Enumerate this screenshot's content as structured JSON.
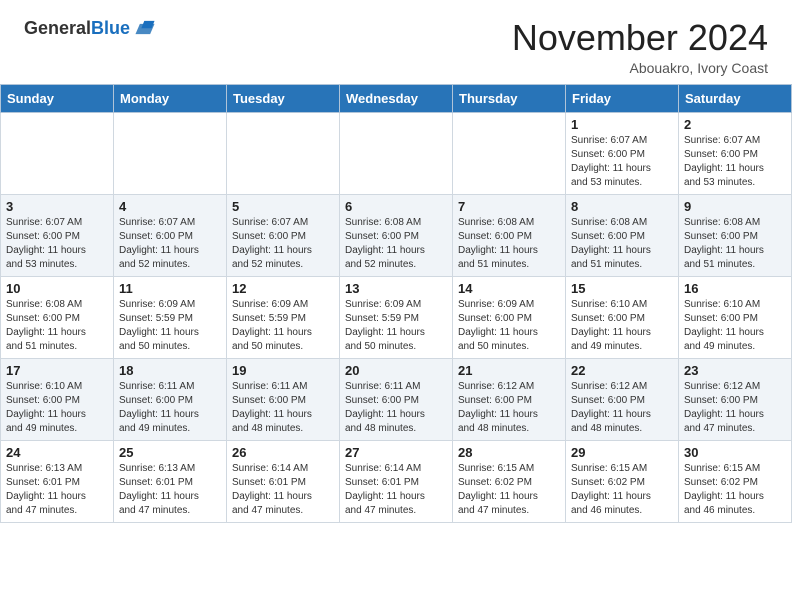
{
  "header": {
    "logo_general": "General",
    "logo_blue": "Blue",
    "month": "November 2024",
    "location": "Abouakro, Ivory Coast"
  },
  "calendar": {
    "days_of_week": [
      "Sunday",
      "Monday",
      "Tuesday",
      "Wednesday",
      "Thursday",
      "Friday",
      "Saturday"
    ],
    "weeks": [
      [
        {
          "day": "",
          "info": ""
        },
        {
          "day": "",
          "info": ""
        },
        {
          "day": "",
          "info": ""
        },
        {
          "day": "",
          "info": ""
        },
        {
          "day": "",
          "info": ""
        },
        {
          "day": "1",
          "info": "Sunrise: 6:07 AM\nSunset: 6:00 PM\nDaylight: 11 hours\nand 53 minutes."
        },
        {
          "day": "2",
          "info": "Sunrise: 6:07 AM\nSunset: 6:00 PM\nDaylight: 11 hours\nand 53 minutes."
        }
      ],
      [
        {
          "day": "3",
          "info": "Sunrise: 6:07 AM\nSunset: 6:00 PM\nDaylight: 11 hours\nand 53 minutes."
        },
        {
          "day": "4",
          "info": "Sunrise: 6:07 AM\nSunset: 6:00 PM\nDaylight: 11 hours\nand 52 minutes."
        },
        {
          "day": "5",
          "info": "Sunrise: 6:07 AM\nSunset: 6:00 PM\nDaylight: 11 hours\nand 52 minutes."
        },
        {
          "day": "6",
          "info": "Sunrise: 6:08 AM\nSunset: 6:00 PM\nDaylight: 11 hours\nand 52 minutes."
        },
        {
          "day": "7",
          "info": "Sunrise: 6:08 AM\nSunset: 6:00 PM\nDaylight: 11 hours\nand 51 minutes."
        },
        {
          "day": "8",
          "info": "Sunrise: 6:08 AM\nSunset: 6:00 PM\nDaylight: 11 hours\nand 51 minutes."
        },
        {
          "day": "9",
          "info": "Sunrise: 6:08 AM\nSunset: 6:00 PM\nDaylight: 11 hours\nand 51 minutes."
        }
      ],
      [
        {
          "day": "10",
          "info": "Sunrise: 6:08 AM\nSunset: 6:00 PM\nDaylight: 11 hours\nand 51 minutes."
        },
        {
          "day": "11",
          "info": "Sunrise: 6:09 AM\nSunset: 5:59 PM\nDaylight: 11 hours\nand 50 minutes."
        },
        {
          "day": "12",
          "info": "Sunrise: 6:09 AM\nSunset: 5:59 PM\nDaylight: 11 hours\nand 50 minutes."
        },
        {
          "day": "13",
          "info": "Sunrise: 6:09 AM\nSunset: 5:59 PM\nDaylight: 11 hours\nand 50 minutes."
        },
        {
          "day": "14",
          "info": "Sunrise: 6:09 AM\nSunset: 6:00 PM\nDaylight: 11 hours\nand 50 minutes."
        },
        {
          "day": "15",
          "info": "Sunrise: 6:10 AM\nSunset: 6:00 PM\nDaylight: 11 hours\nand 49 minutes."
        },
        {
          "day": "16",
          "info": "Sunrise: 6:10 AM\nSunset: 6:00 PM\nDaylight: 11 hours\nand 49 minutes."
        }
      ],
      [
        {
          "day": "17",
          "info": "Sunrise: 6:10 AM\nSunset: 6:00 PM\nDaylight: 11 hours\nand 49 minutes."
        },
        {
          "day": "18",
          "info": "Sunrise: 6:11 AM\nSunset: 6:00 PM\nDaylight: 11 hours\nand 49 minutes."
        },
        {
          "day": "19",
          "info": "Sunrise: 6:11 AM\nSunset: 6:00 PM\nDaylight: 11 hours\nand 48 minutes."
        },
        {
          "day": "20",
          "info": "Sunrise: 6:11 AM\nSunset: 6:00 PM\nDaylight: 11 hours\nand 48 minutes."
        },
        {
          "day": "21",
          "info": "Sunrise: 6:12 AM\nSunset: 6:00 PM\nDaylight: 11 hours\nand 48 minutes."
        },
        {
          "day": "22",
          "info": "Sunrise: 6:12 AM\nSunset: 6:00 PM\nDaylight: 11 hours\nand 48 minutes."
        },
        {
          "day": "23",
          "info": "Sunrise: 6:12 AM\nSunset: 6:00 PM\nDaylight: 11 hours\nand 47 minutes."
        }
      ],
      [
        {
          "day": "24",
          "info": "Sunrise: 6:13 AM\nSunset: 6:01 PM\nDaylight: 11 hours\nand 47 minutes."
        },
        {
          "day": "25",
          "info": "Sunrise: 6:13 AM\nSunset: 6:01 PM\nDaylight: 11 hours\nand 47 minutes."
        },
        {
          "day": "26",
          "info": "Sunrise: 6:14 AM\nSunset: 6:01 PM\nDaylight: 11 hours\nand 47 minutes."
        },
        {
          "day": "27",
          "info": "Sunrise: 6:14 AM\nSunset: 6:01 PM\nDaylight: 11 hours\nand 47 minutes."
        },
        {
          "day": "28",
          "info": "Sunrise: 6:15 AM\nSunset: 6:02 PM\nDaylight: 11 hours\nand 47 minutes."
        },
        {
          "day": "29",
          "info": "Sunrise: 6:15 AM\nSunset: 6:02 PM\nDaylight: 11 hours\nand 46 minutes."
        },
        {
          "day": "30",
          "info": "Sunrise: 6:15 AM\nSunset: 6:02 PM\nDaylight: 11 hours\nand 46 minutes."
        }
      ]
    ]
  }
}
